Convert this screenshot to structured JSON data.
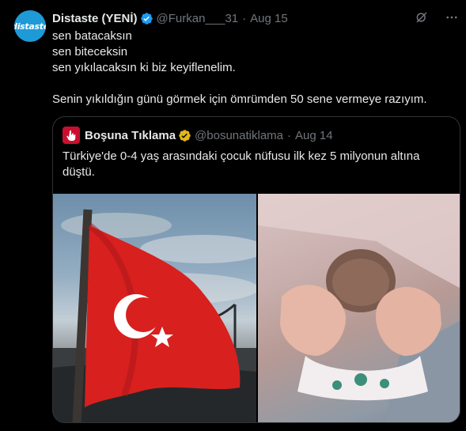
{
  "author": {
    "name": "Distaste (YENİ)",
    "handle": "@Furkan___31",
    "date": "Aug 15",
    "avatar_text": "distaste"
  },
  "body": {
    "line1": "sen batacaksın",
    "line2": "sen biteceksin",
    "line3": "sen yıkılacaksın ki biz keyiflenelim.",
    "line4": "Senin yıkıldığın günü görmek için ömrümden 50 sene vermeye razıyım."
  },
  "quote": {
    "name": "Boşuna Tıklama",
    "handle": "@bosunatiklama",
    "date": "Aug 14",
    "text": "Türkiye'de 0-4 yaş arasındaki çocuk nüfusu ilk kez 5 milyonun altına düştü."
  },
  "colors": {
    "background": "#000000",
    "text": "#e7e9ea",
    "muted": "#71767b",
    "verified": "#1d9bf0",
    "gold_verified": "#e2b719",
    "border": "#2f3336"
  },
  "icons": [
    "grok-icon",
    "more-icon",
    "verified-badge-icon",
    "gold-verified-badge-icon"
  ]
}
